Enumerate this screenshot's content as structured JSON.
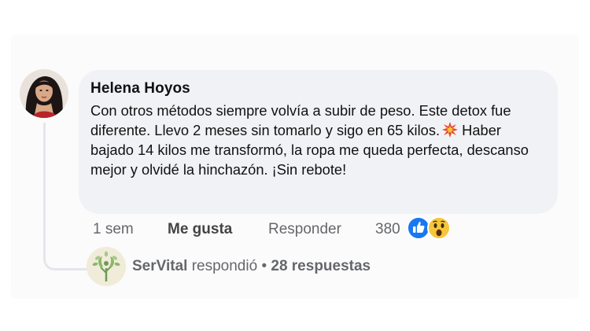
{
  "comment": {
    "author": "Helena Hoyos",
    "text_part1": "Con otros métodos siempre volvía a subir de peso. Este detox fue diferente. Llevo 2 meses sin tomarlo y sigo en 65 kilos.",
    "text_part2": "Haber bajado 14 kilos me transformó, la ropa me queda perfecta, descanso mejor y olvidé la hinchazón. ¡Sin rebote!",
    "avatar_icon": "profile-photo-woman",
    "inline_emoji": "collision-burst-icon"
  },
  "actions": {
    "time": "1 sem",
    "like_label": "Me gusta",
    "reply_label": "Responder",
    "reaction_count": "380",
    "reactions": [
      "like-reaction-icon",
      "wow-reaction-icon"
    ]
  },
  "reply_summary": {
    "author": "SerVital",
    "verb": "respondió",
    "separator": "•",
    "count_label": "28 respuestas",
    "avatar_icon": "servital-tree-logo"
  },
  "colors": {
    "bubble": "#f0f2f5",
    "muted_text": "#65676b",
    "like_blue": "#1877f2",
    "wow_yellow": "#f7c53a"
  }
}
